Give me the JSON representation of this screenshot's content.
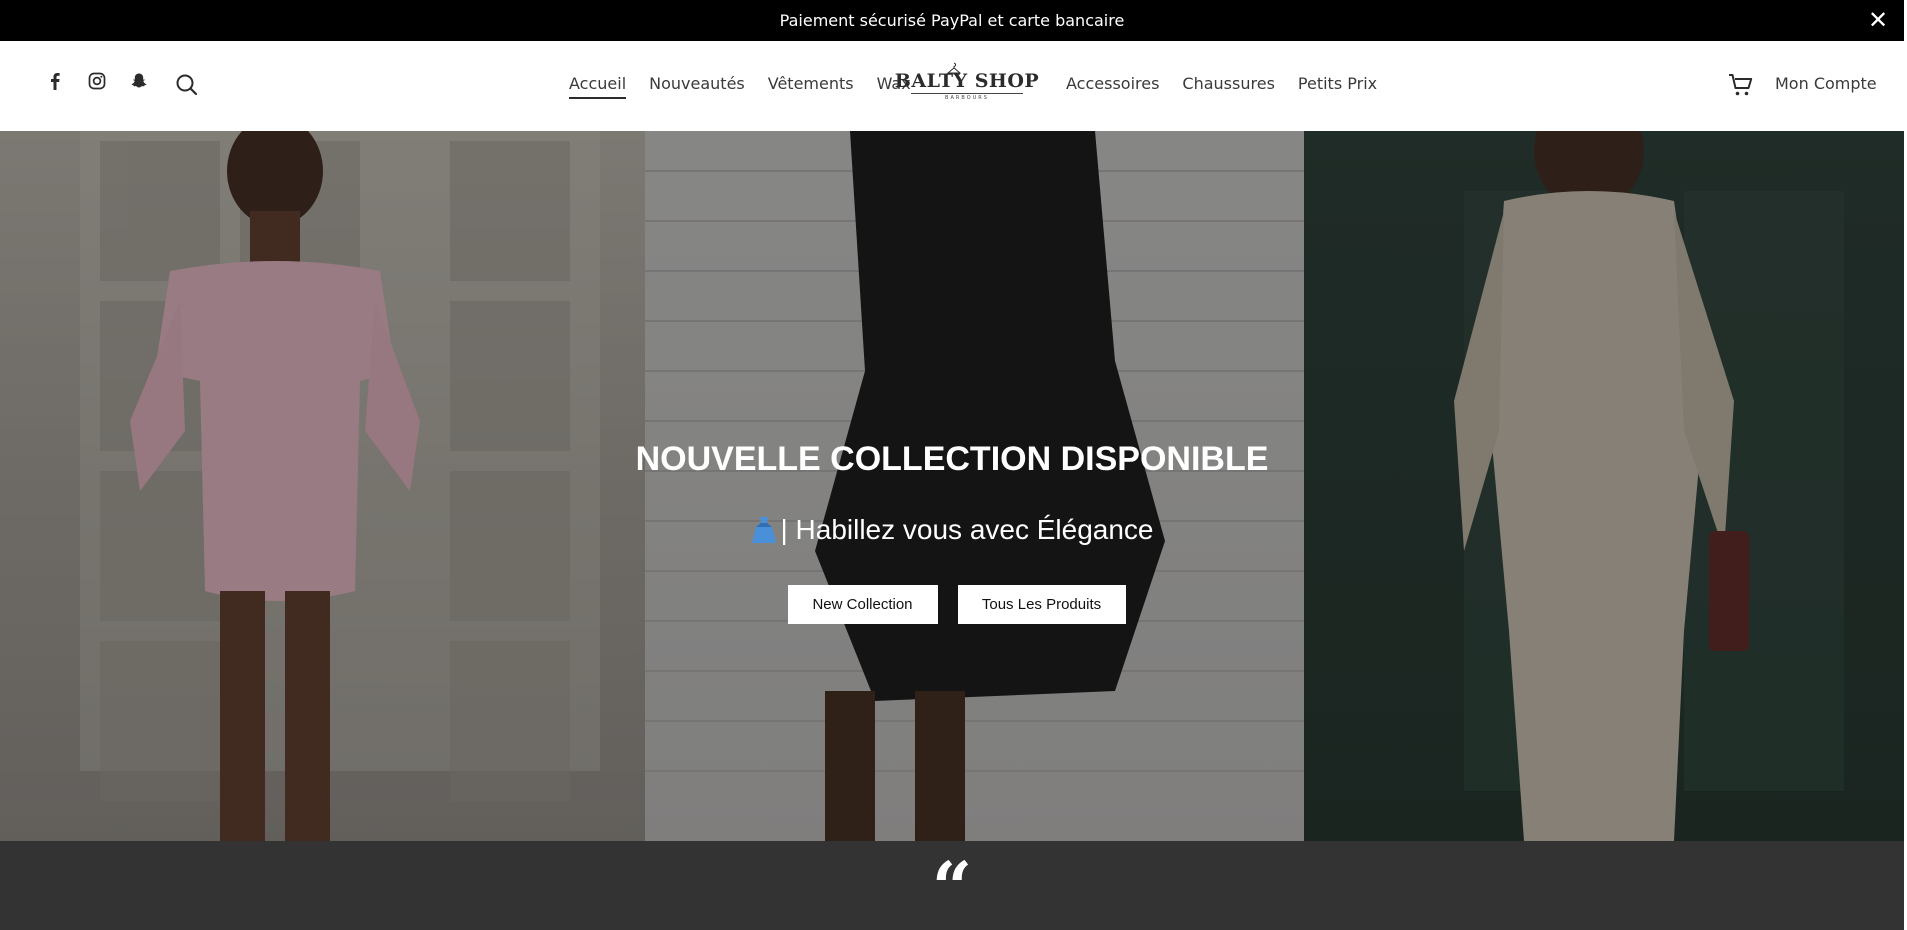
{
  "announcement": {
    "text": "Paiement sécurisé PayPal et carte bancaire",
    "close_label": "✕"
  },
  "header": {
    "social": [
      {
        "name": "facebook-icon"
      },
      {
        "name": "instagram-icon"
      },
      {
        "name": "snapchat-icon"
      }
    ],
    "nav_left": [
      {
        "label": "Accueil",
        "active": true
      },
      {
        "label": "Nouveautés"
      },
      {
        "label": "Vêtements"
      },
      {
        "label": "Wax"
      }
    ],
    "logo": {
      "text": "BALTY SHOP",
      "tagline": "BARBOURS"
    },
    "nav_right": [
      {
        "label": "Accessoires"
      },
      {
        "label": "Chaussures"
      },
      {
        "label": "Petits Prix"
      }
    ],
    "account_label": "Mon Compte"
  },
  "hero": {
    "title": "NOUVELLE COLLECTION DISPONIBLE",
    "subtitle": "| Habillez vous avec Élégance",
    "buttons": [
      {
        "label": "New Collection"
      },
      {
        "label": "Tous Les Produits"
      }
    ]
  },
  "band": {
    "quote_glyph": "“"
  },
  "colors": {
    "announce_bg": "#000000",
    "band_bg": "#333333",
    "accent_dress": "#4a90d9"
  }
}
